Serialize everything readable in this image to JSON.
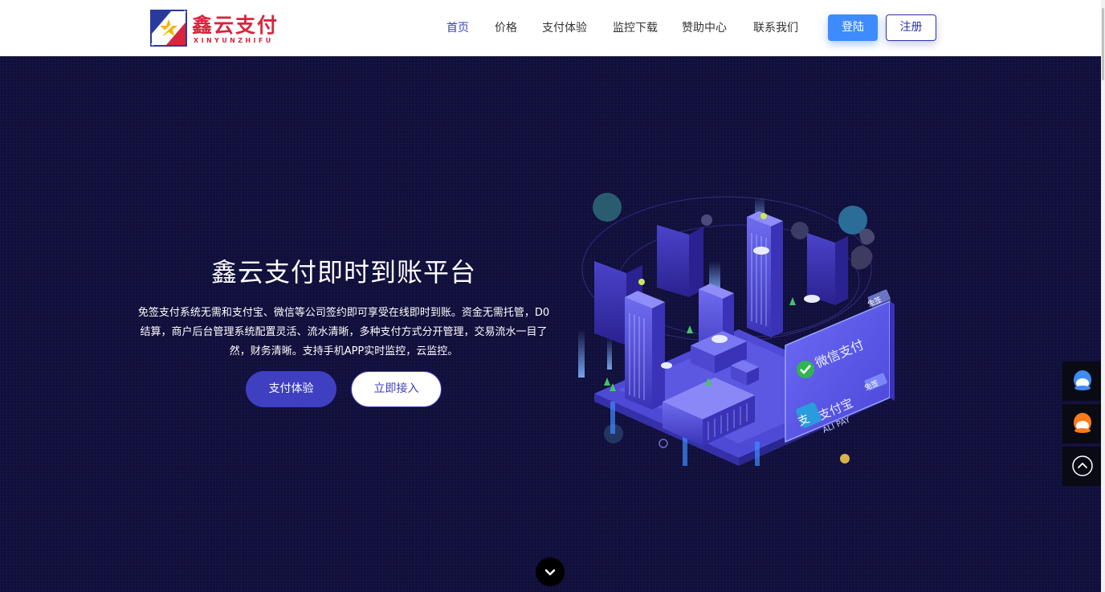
{
  "header": {
    "logo": {
      "text_cn": "鑫云支付",
      "text_en": "XINYUNZHIFU"
    },
    "nav": [
      "首页",
      "价格",
      "支付体验",
      "监控下载",
      "赞助中心",
      "联系我们"
    ],
    "login_label": "登陆",
    "register_label": "注册"
  },
  "hero": {
    "title": "鑫云支付即时到账平台",
    "description": "免签支付系统无需和支付宝、微信等公司签约即可享受在线即时到账。资金无需托管，D0结算，商户后台管理系统配置灵活、流水清晰，多种支付方式分开管理，交易流水一目了然，财务清晰。支持手机APP实时监控，云监控。",
    "primary_button": "支付体验",
    "secondary_button": "立即接入",
    "illustration": {
      "wechat_label": "微信支付",
      "alipay_label": "支付宝",
      "alipay_en": "ALI PAY",
      "badge": "免签"
    }
  },
  "side_tools": [
    {
      "icon": "qq-icon",
      "color": "#4a9bff"
    },
    {
      "icon": "qq-icon",
      "color": "#ff8a2a"
    },
    {
      "icon": "back-to-top-icon",
      "color": "#ffffff"
    }
  ],
  "colors": {
    "hero_bg": "#100e3b",
    "accent": "#3f3fc2",
    "login_bg": "#3d8bfd",
    "logo_red": "#d7263d"
  }
}
